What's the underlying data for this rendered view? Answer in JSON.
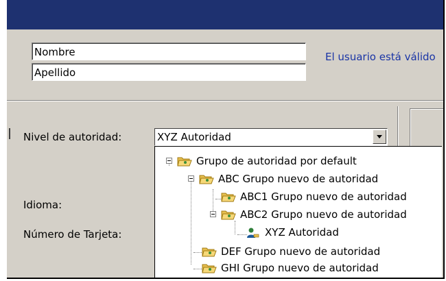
{
  "form": {
    "first_name": "Nombre",
    "last_name": "Apellido",
    "status_text": "El usuario está válido",
    "authority_label": "Nivel de autoridad:",
    "authority_value": "XYZ Autoridad",
    "language_label": "Idioma:",
    "card_label": "Número de Tarjeta:"
  },
  "tree": {
    "items": [
      {
        "label": "Grupo de autoridad por default",
        "level": 0,
        "icon": "folder-group-icon",
        "expanded": true
      },
      {
        "label": "ABC Grupo nuevo de autoridad",
        "level": 1,
        "icon": "folder-group-icon",
        "expanded": true
      },
      {
        "label": "ABC1 Grupo nuevo de autoridad",
        "level": 2,
        "icon": "folder-group-icon",
        "expanded": false
      },
      {
        "label": "ABC2 Grupo nuevo de autoridad",
        "level": 2,
        "icon": "folder-group-icon",
        "expanded": true
      },
      {
        "label": "XYZ Autoridad",
        "level": 3,
        "icon": "user-authority-icon",
        "expanded": false
      },
      {
        "label": "DEF Grupo nuevo de autoridad",
        "level": 1,
        "icon": "folder-group-icon",
        "expanded": false
      },
      {
        "label": "GHI Grupo nuevo de autoridad",
        "level": 1,
        "icon": "folder-group-icon",
        "expanded": false
      }
    ]
  },
  "colors": {
    "titlebar": "#1e3170",
    "dialog_bg": "#d4d0c8",
    "status_text": "#1a35a6"
  }
}
